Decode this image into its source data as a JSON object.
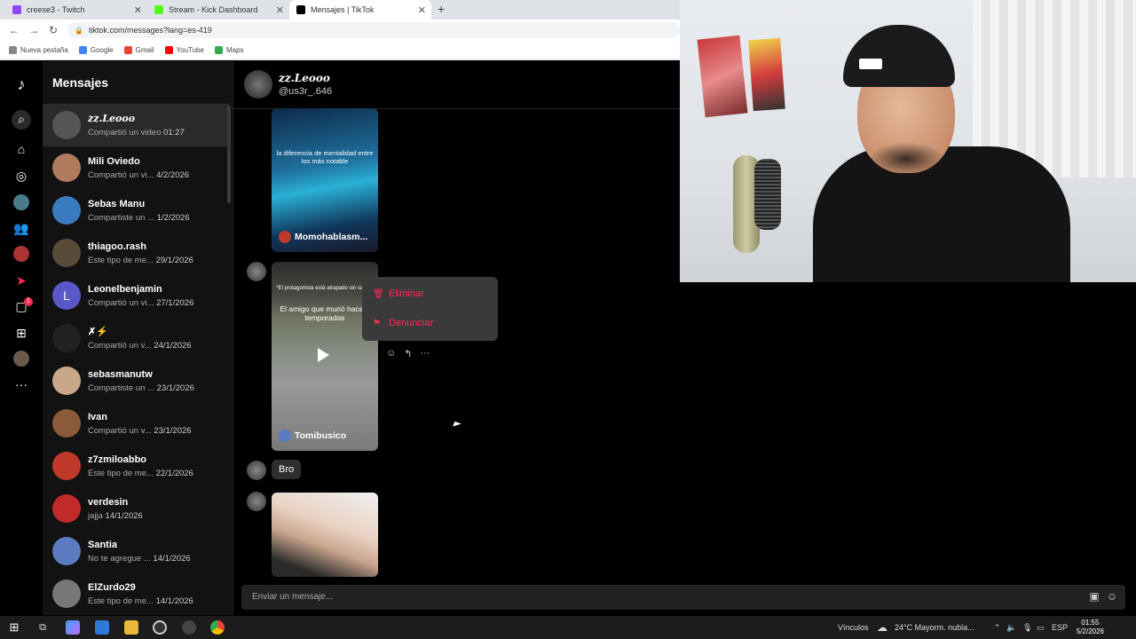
{
  "browser": {
    "tabs": [
      {
        "title": "creese3 - Twitch",
        "color": "#9146ff"
      },
      {
        "title": "Stream - Kick Dashboard",
        "color": "#53fc18"
      },
      {
        "title": "Mensajes | TikTok",
        "color": "#000000"
      }
    ],
    "url": "tiktok.com/messages?lang=es-419",
    "bookmarks": [
      "Nueva pestaña",
      "Google",
      "Gmail",
      "YouTube",
      "Maps"
    ]
  },
  "inbox": {
    "title": "Mensajes",
    "conversations": [
      {
        "name": "zz.Leooo",
        "preview": "Compartió un video",
        "time": "01:27",
        "avatar": "#555555"
      },
      {
        "name": "Mili Oviedo",
        "preview": "Compartió un vi...",
        "time": "4/2/2026",
        "avatar": "#b07a5e"
      },
      {
        "name": "Sebas Manu",
        "preview": "Compartiste un ...",
        "time": "1/2/2026",
        "avatar": "#3a7bbf"
      },
      {
        "name": "thiagoo.rash",
        "preview": "Este tipo de me...",
        "time": "29/1/2026",
        "avatar": "#5a4a3a"
      },
      {
        "name": "Leonelbenjamin",
        "preview": "Compartió un vi...",
        "time": "27/1/2026",
        "avatar": "#5a57c9",
        "initial": "L"
      },
      {
        "name": "✗⚡",
        "preview": "Compartió un v...",
        "time": "24/1/2026",
        "avatar": "#222222"
      },
      {
        "name": "sebasmanutw",
        "preview": "Compartiste un ...",
        "time": "23/1/2026",
        "avatar": "#c9a88a"
      },
      {
        "name": "Ivan",
        "preview": "Compartió un v...",
        "time": "23/1/2026",
        "avatar": "#8a5a3a"
      },
      {
        "name": "z7zmiloabbo",
        "preview": "Este tipo de me...",
        "time": "22/1/2026",
        "avatar": "#c0392b"
      },
      {
        "name": "verdesin",
        "preview": "jajja",
        "time": "14/1/2026",
        "avatar": "#c02a2a"
      },
      {
        "name": "Santia",
        "preview": "No te agregue ...",
        "time": "14/1/2026",
        "avatar": "#5a7bbf"
      },
      {
        "name": "ElZurdo29",
        "preview": "Este tipo de me...",
        "time": "14/1/2026",
        "avatar": "#777777"
      }
    ]
  },
  "chat": {
    "name": "zz.Leooo",
    "username": "@us3r_.646",
    "video1": {
      "overlay": "la diferencia de mentalidad entre los más notable",
      "author": "Momohablasm..."
    },
    "video2": {
      "overlay_top": "*El protagonista está atrapado sin salida*",
      "overlay": "El amigo que murió hace 3 temporadas",
      "author": "Tomibusico"
    },
    "bubble": "Bro",
    "menu": {
      "delete": "Eliminar",
      "report": "Denunciar"
    },
    "composer_placeholder": "Enviar un mensaje..."
  },
  "taskbar": {
    "links": "Vínculos",
    "weather": "24°C  Mayorm. nubla...",
    "lang": "ESP",
    "time": "01:55",
    "date": "5/2/2026"
  }
}
